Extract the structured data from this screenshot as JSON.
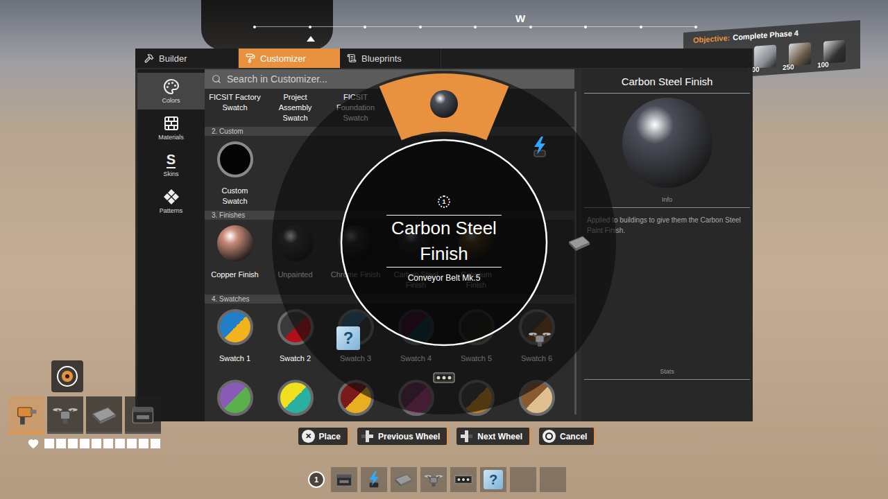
{
  "compass": {
    "heading": "W"
  },
  "objective": {
    "label": "Objective:",
    "text": "Complete Phase 4",
    "items": [
      {
        "kind": "frame",
        "count": "500"
      },
      {
        "kind": "motor",
        "count": "250"
      },
      {
        "kind": "cube",
        "count": "100"
      }
    ]
  },
  "tabs": [
    {
      "label": "Builder",
      "kind": "builder",
      "selected": false
    },
    {
      "label": "Customizer",
      "kind": "customizer",
      "selected": true
    },
    {
      "label": "Blueprints",
      "kind": "blueprints",
      "selected": false
    }
  ],
  "sidebar": {
    "items": [
      {
        "label": "Colors",
        "kind": "palette",
        "selected": true
      },
      {
        "label": "Materials",
        "kind": "bricks",
        "selected": false
      },
      {
        "label": "Skins",
        "kind": "skin",
        "glyph": "S",
        "selected": false
      },
      {
        "label": "Patterns",
        "kind": "pattern",
        "selected": false
      }
    ]
  },
  "search": {
    "placeholder": "Search in Customizer..."
  },
  "presets": [
    {
      "label": "FICSIT Factory Swatch"
    },
    {
      "label": "Project Assembly Swatch"
    },
    {
      "label": "FICSIT Foundation Swatch"
    }
  ],
  "sections": [
    {
      "title": "2. Custom",
      "items": [
        {
          "label": "Custom Swatch",
          "kind": "custom",
          "colors": [
            "#050505"
          ]
        }
      ]
    },
    {
      "title": "3. Finishes",
      "items": [
        {
          "label": "Copper Finish",
          "kind": "finish",
          "colors": [
            "#c98a78"
          ]
        },
        {
          "label": "Unpainted",
          "kind": "finish",
          "colors": [
            "#3a3a3a"
          ]
        },
        {
          "label": "Chrome Finish",
          "kind": "finish",
          "colors": [
            "#555a60"
          ]
        },
        {
          "label": "Carbon Steel Finish",
          "kind": "finish",
          "colors": [
            "#4a4e58"
          ]
        },
        {
          "label": "Caterium Finish",
          "kind": "finish",
          "colors": [
            "#a07a30"
          ]
        }
      ]
    },
    {
      "title": "4. Swatches",
      "items": [
        {
          "label": "Swatch 1",
          "kind": "swatch",
          "colors": [
            "#1f7fc9",
            "#f2b31c"
          ]
        },
        {
          "label": "Swatch 2",
          "kind": "swatch",
          "colors": [
            "#3a3a3a",
            "#b0101a"
          ]
        },
        {
          "label": "Swatch 3",
          "kind": "swatch",
          "colors": [
            "#2a5d7a",
            "#333333"
          ]
        },
        {
          "label": "Swatch 4",
          "kind": "swatch",
          "colors": [
            "#7a2a6a",
            "#1f7f8a"
          ]
        },
        {
          "label": "Swatch 5",
          "kind": "swatch",
          "colors": [
            "#3a3a3a",
            "#4a4a2a"
          ]
        },
        {
          "label": "Swatch 6",
          "kind": "swatch",
          "colors": [
            "#3a3a3a",
            "#7a4a22"
          ]
        },
        {
          "kind": "swatch",
          "colors": [
            "#8a5ab8",
            "#5ab04a"
          ]
        },
        {
          "kind": "swatch",
          "colors": [
            "#f0e020",
            "#2ab0a0"
          ]
        },
        {
          "kind": "swatch",
          "colors": [
            "#7a1a1a",
            "#e8b020"
          ]
        },
        {
          "kind": "swatch",
          "colors": [
            "#5a2a4a",
            "#a03a7a"
          ]
        },
        {
          "kind": "swatch",
          "colors": [
            "#3a3a3a",
            "#c08020"
          ]
        },
        {
          "kind": "swatch",
          "colors": [
            "#8a5a30",
            "#e0c090"
          ]
        }
      ]
    }
  ],
  "detail": {
    "title": "Carbon Steel Finish",
    "caption": "Info",
    "description": "Applied to buildings to give them the Carbon Steel Paint Finish.",
    "stats_label": "Stats"
  },
  "wheel": {
    "number": "1",
    "title": "Carbon Steel Finish",
    "subtitle": "Conveyor Belt Mk.5",
    "slots": [
      {
        "kind": "finish",
        "selected": true
      },
      {
        "kind": "power",
        "selected": false
      },
      {
        "kind": "foundation",
        "selected": false
      },
      {
        "kind": "drone",
        "selected": false
      },
      {
        "kind": "conveyor",
        "selected": false
      },
      {
        "kind": "unknown",
        "glyph": "?",
        "selected": false
      },
      {
        "kind": "empty",
        "selected": false
      },
      {
        "kind": "empty",
        "selected": false
      }
    ]
  },
  "prompts": [
    {
      "kind": "cross",
      "glyph": "✕",
      "label": "Place"
    },
    {
      "kind": "dpad-left",
      "label": "Previous Wheel"
    },
    {
      "kind": "dpad-right",
      "label": "Next Wheel"
    },
    {
      "kind": "circle",
      "label": "Cancel"
    }
  ],
  "hotbar": {
    "number": "1",
    "slots": [
      {
        "kind": "machine"
      },
      {
        "kind": "power"
      },
      {
        "kind": "foundation"
      },
      {
        "kind": "drone"
      },
      {
        "kind": "conveyor"
      },
      {
        "kind": "unknown",
        "glyph": "?"
      },
      {
        "kind": "empty"
      },
      {
        "kind": "empty"
      }
    ]
  },
  "equipment": {
    "slots": [
      {
        "kind": "tool"
      },
      {
        "kind": "drone"
      },
      {
        "kind": "foundation"
      },
      {
        "kind": "machine"
      }
    ]
  },
  "health": {
    "level": 1
  }
}
